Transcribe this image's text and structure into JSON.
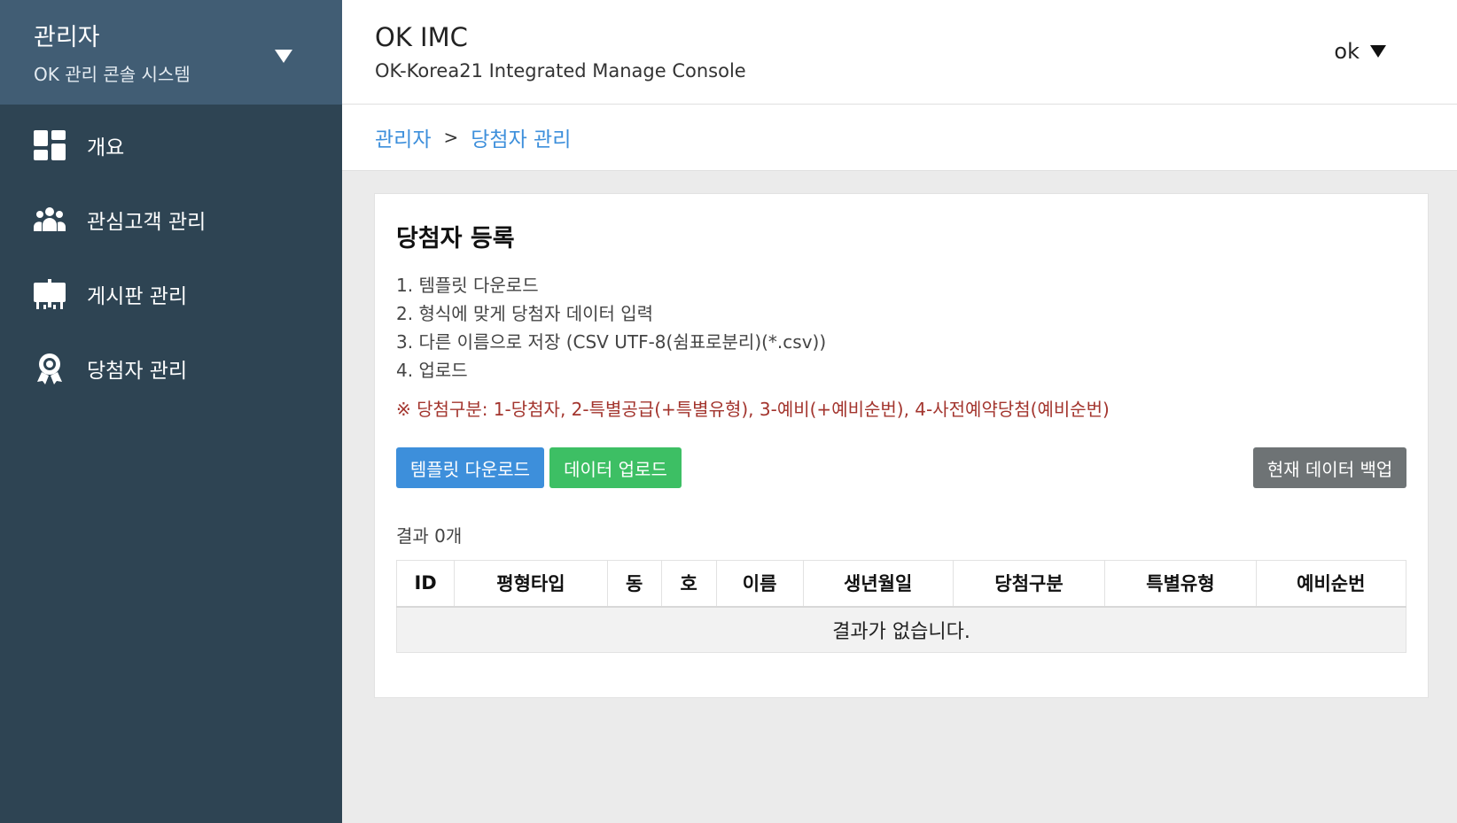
{
  "sidebar": {
    "role": "관리자",
    "system": "OK 관리 콘솔 시스템",
    "items": [
      {
        "label": "개요",
        "icon": "dashboard-icon"
      },
      {
        "label": "관심고객 관리",
        "icon": "users-icon"
      },
      {
        "label": "게시판 관리",
        "icon": "board-icon"
      },
      {
        "label": "당첨자 관리",
        "icon": "award-icon"
      }
    ]
  },
  "header": {
    "title": "OK IMC",
    "subtitle": "OK-Korea21 Integrated Manage Console",
    "user": "ok"
  },
  "breadcrumb": {
    "root": "관리자",
    "separator": ">",
    "current": "당첨자 관리"
  },
  "card": {
    "title": "당첨자 등록",
    "steps": [
      "1. 템플릿 다운로드",
      "2. 형식에 맞게 당첨자 데이터 입력",
      "3. 다른 이름으로 저장 (CSV UTF-8(쉼표로분리)(*.csv))",
      "4. 업로드"
    ],
    "note": "※ 당첨구분: 1-당첨자, 2-특별공급(+특별유형), 3-예비(+예비순번), 4-사전예약당첨(예비순번)",
    "buttons": {
      "template_download": "템플릿 다운로드",
      "data_upload": "데이터 업로드",
      "backup": "현재 데이터 백업"
    },
    "result_count": "결과 0개",
    "table": {
      "headers": [
        "ID",
        "평형타입",
        "동",
        "호",
        "이름",
        "생년월일",
        "당첨구분",
        "특별유형",
        "예비순번"
      ],
      "empty_text": "결과가 없습니다."
    }
  },
  "colors": {
    "sidebar_bg": "#2e4453",
    "sidebar_head_bg": "#415d74",
    "accent_blue": "#3d8fdb",
    "accent_green": "#3dbf64",
    "button_gray": "#6e7375",
    "note_red": "#a3352e"
  }
}
